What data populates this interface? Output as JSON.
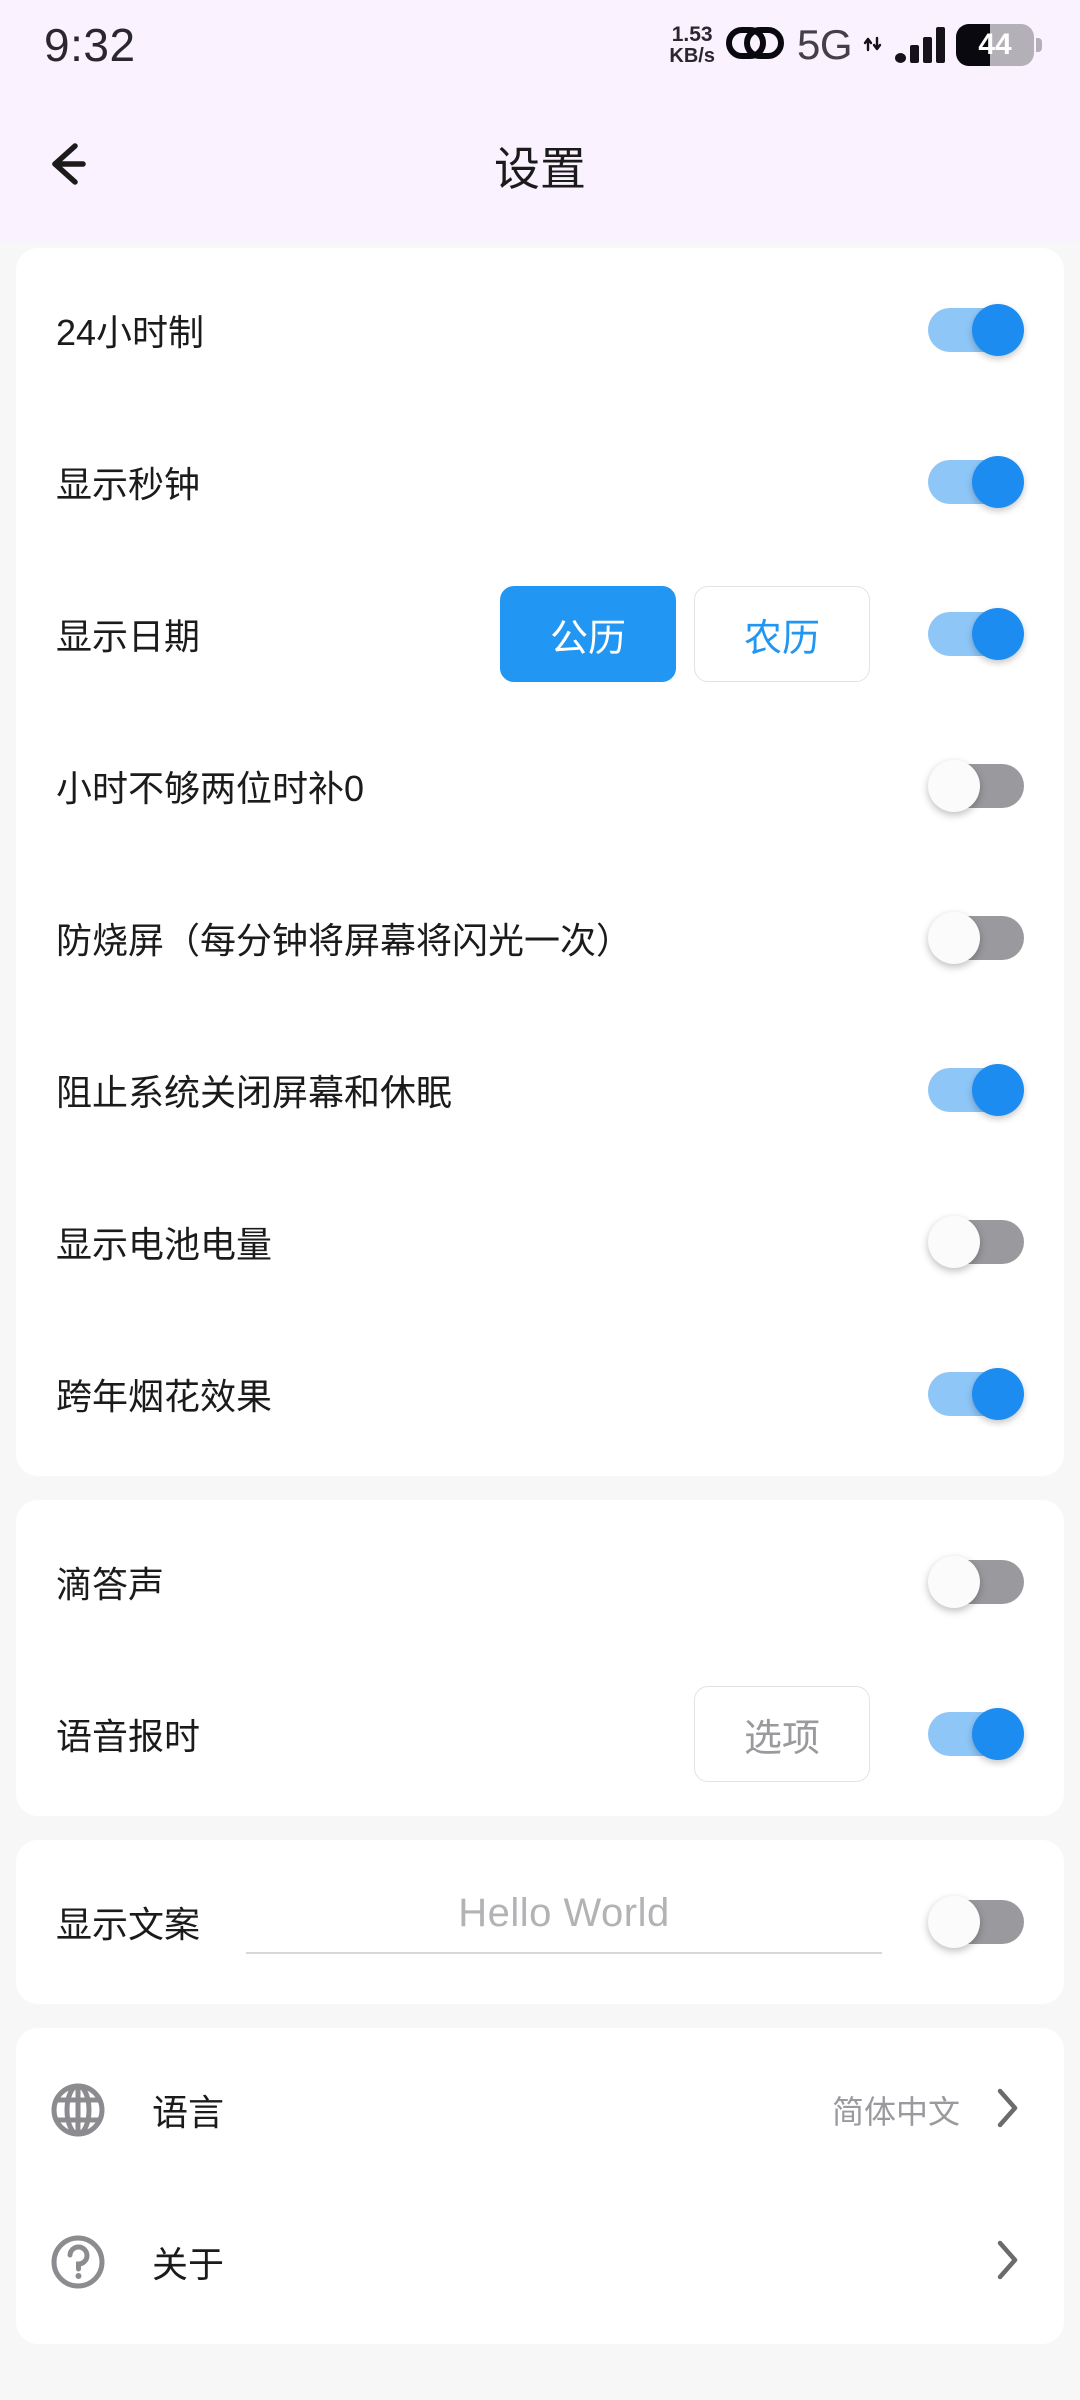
{
  "status_bar": {
    "time": "9:32",
    "net_speed_value": "1.53",
    "net_speed_unit": "KB/s",
    "link_icon": "link-icon",
    "network_type": "5G",
    "data_arrows_icon": "data-transfer-icon",
    "signal_icon": "signal-bars-icon",
    "battery_level": "44",
    "battery_percent": 44
  },
  "header": {
    "back_icon": "back-arrow-icon",
    "title": "设置"
  },
  "cards": {
    "display": {
      "rows": [
        {
          "label": "24小时制",
          "toggle": "on"
        },
        {
          "label": "显示秒钟",
          "toggle": "on"
        },
        {
          "label": "显示日期",
          "toggle": "on",
          "segments": [
            {
              "label": "公历",
              "selected": true
            },
            {
              "label": "农历",
              "selected": false
            }
          ]
        },
        {
          "label": "小时不够两位时补0",
          "toggle": "off"
        },
        {
          "label": "防烧屏（每分钟将屏幕将闪光一次）",
          "toggle": "off"
        },
        {
          "label": "阻止系统关闭屏幕和休眠",
          "toggle": "on"
        },
        {
          "label": "显示电池电量",
          "toggle": "off"
        },
        {
          "label": "跨年烟花效果",
          "toggle": "on"
        }
      ]
    },
    "sound": {
      "rows": [
        {
          "label": "滴答声",
          "toggle": "off"
        },
        {
          "label": "语音报时",
          "toggle": "on",
          "button": "选项"
        }
      ]
    },
    "text": {
      "row": {
        "label": "显示文案",
        "placeholder": "Hello World",
        "value": "",
        "toggle": "off"
      }
    },
    "nav": {
      "rows": [
        {
          "icon": "globe-icon",
          "label": "语言",
          "value": "简体中文",
          "chevron": "›"
        },
        {
          "icon": "help-circle-icon",
          "label": "关于",
          "value": "",
          "chevron": "›"
        }
      ]
    }
  },
  "colors": {
    "accent": "#2196f3",
    "toggle_on_track": "#8dc6f7",
    "toggle_on_thumb": "#1d8cf0",
    "toggle_off_track": "#9a9a9e",
    "header_bg": "#faf2fe",
    "page_bg": "#f7f7f8",
    "card_bg": "#ffffff"
  }
}
